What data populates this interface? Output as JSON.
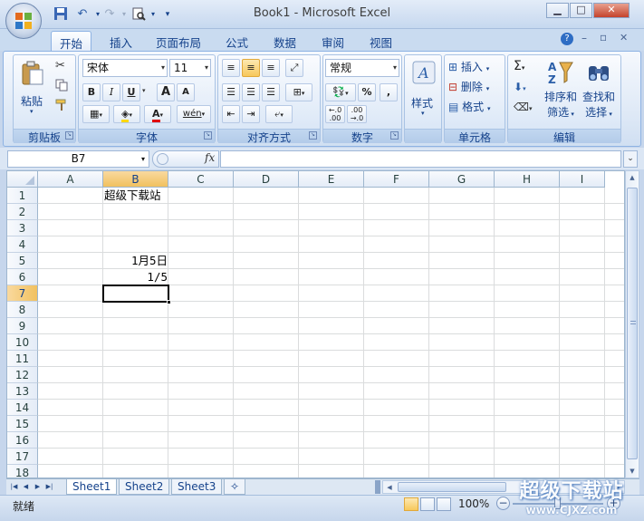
{
  "window": {
    "title": "Book1 - Microsoft Excel",
    "minimize": "▁",
    "maximize": "□",
    "close": "✕"
  },
  "ribbon_tabs": [
    "开始",
    "插入",
    "页面布局",
    "公式",
    "数据",
    "审阅",
    "视图"
  ],
  "ribbon_right_icons": [
    "?",
    "–",
    "▫",
    "✕"
  ],
  "clipboard": {
    "paste": "粘贴",
    "label": "剪贴板"
  },
  "font": {
    "name": "宋体",
    "size": "11",
    "bold": "B",
    "italic": "I",
    "underline": "U",
    "grow": "A",
    "shrink": "A",
    "phonetic": "wén",
    "label": "字体"
  },
  "alignment": {
    "label": "对齐方式"
  },
  "number": {
    "format": "常规",
    "percent": "%",
    "comma": ",",
    "inc": ".0\n.00",
    "dec": ".00\n.0",
    "label": "数字"
  },
  "styles": {
    "label": "样式"
  },
  "cells": {
    "insert": "插入",
    "delete": "删除",
    "format": "格式",
    "label": "单元格"
  },
  "editing": {
    "sum": "Σ",
    "sort1": "排序和",
    "sort2": "筛选",
    "find1": "查找和",
    "find2": "选择",
    "label": "编辑"
  },
  "formula_bar": {
    "name_box": "B7",
    "fx": "fx",
    "formula": ""
  },
  "columns": [
    "A",
    "B",
    "C",
    "D",
    "E",
    "F",
    "G",
    "H",
    "I"
  ],
  "selected_column": "B",
  "rows": [
    "1",
    "2",
    "3",
    "4",
    "5",
    "6",
    "7",
    "8",
    "9",
    "10",
    "11",
    "12",
    "13",
    "14",
    "15",
    "16",
    "17",
    "18"
  ],
  "selected_row": "7",
  "cells_content": {
    "B1": "超级下载站",
    "B5": "1月5日",
    "B6": "1/5"
  },
  "sheet_tabs": [
    "Sheet1",
    "Sheet2",
    "Sheet3"
  ],
  "active_sheet": "Sheet1",
  "status": {
    "text": "就绪",
    "zoom": "100%"
  },
  "watermark": {
    "cn": "超级下载站",
    "url": "www.CJXZ.com"
  }
}
